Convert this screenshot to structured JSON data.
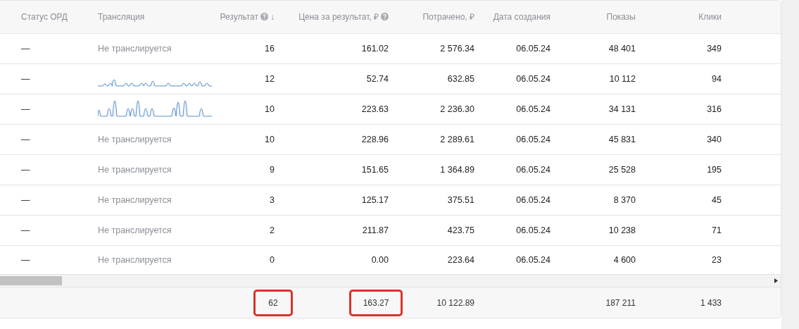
{
  "table": {
    "columns": [
      {
        "label": "Статус ОРД"
      },
      {
        "label": "Трансляция"
      },
      {
        "label": "Результат",
        "help": true,
        "sorted": true,
        "sort_mark": "↓"
      },
      {
        "label": "Цена за результат, ₽",
        "help": true
      },
      {
        "label": "Потрачено, ₽"
      },
      {
        "label": "Дата создания"
      },
      {
        "label": "Показы"
      },
      {
        "label": "Клики"
      }
    ],
    "rows": [
      {
        "cells": [
          {
            "kind": "text",
            "text": "—"
          },
          {
            "kind": "text",
            "text": "Не транслируется"
          },
          {
            "kind": "text",
            "text": "16"
          },
          {
            "kind": "text",
            "text": "161.02"
          },
          {
            "kind": "text",
            "text": "2 576.34"
          },
          {
            "kind": "text",
            "text": "06.05.24"
          },
          {
            "kind": "text",
            "text": "48 401"
          },
          {
            "kind": "text",
            "text": "349"
          }
        ]
      },
      {
        "cells": [
          {
            "kind": "text",
            "text": "—"
          },
          {
            "kind": "sparkline"
          },
          {
            "kind": "text",
            "text": "12"
          },
          {
            "kind": "text",
            "text": "52.74"
          },
          {
            "kind": "text",
            "text": "632.85"
          },
          {
            "kind": "text",
            "text": "06.05.24"
          },
          {
            "kind": "text",
            "text": "10 112"
          },
          {
            "kind": "text",
            "text": "94"
          }
        ]
      },
      {
        "cells": [
          {
            "kind": "text",
            "text": "—"
          },
          {
            "kind": "sparkline"
          },
          {
            "kind": "text",
            "text": "10"
          },
          {
            "kind": "text",
            "text": "223.63"
          },
          {
            "kind": "text",
            "text": "2 236.30"
          },
          {
            "kind": "text",
            "text": "06.05.24"
          },
          {
            "kind": "text",
            "text": "34 131"
          },
          {
            "kind": "text",
            "text": "316"
          }
        ]
      },
      {
        "cells": [
          {
            "kind": "text",
            "text": "—"
          },
          {
            "kind": "text",
            "text": "Не транслируется"
          },
          {
            "kind": "text",
            "text": "10"
          },
          {
            "kind": "text",
            "text": "228.96"
          },
          {
            "kind": "text",
            "text": "2 289.61"
          },
          {
            "kind": "text",
            "text": "06.05.24"
          },
          {
            "kind": "text",
            "text": "45 831"
          },
          {
            "kind": "text",
            "text": "340"
          }
        ]
      },
      {
        "cells": [
          {
            "kind": "text",
            "text": "—"
          },
          {
            "kind": "text",
            "text": "Не транслируется"
          },
          {
            "kind": "text",
            "text": "9"
          },
          {
            "kind": "text",
            "text": "151.65"
          },
          {
            "kind": "text",
            "text": "1 364.89"
          },
          {
            "kind": "text",
            "text": "06.05.24"
          },
          {
            "kind": "text",
            "text": "25 528"
          },
          {
            "kind": "text",
            "text": "195"
          }
        ]
      },
      {
        "cells": [
          {
            "kind": "text",
            "text": "—"
          },
          {
            "kind": "text",
            "text": "Не транслируется"
          },
          {
            "kind": "text",
            "text": "3"
          },
          {
            "kind": "text",
            "text": "125.17"
          },
          {
            "kind": "text",
            "text": "375.51"
          },
          {
            "kind": "text",
            "text": "06.05.24"
          },
          {
            "kind": "text",
            "text": "8 370"
          },
          {
            "kind": "text",
            "text": "45"
          }
        ]
      },
      {
        "cells": [
          {
            "kind": "text",
            "text": "—"
          },
          {
            "kind": "text",
            "text": "Не транслируется"
          },
          {
            "kind": "text",
            "text": "2"
          },
          {
            "kind": "text",
            "text": "211.87"
          },
          {
            "kind": "text",
            "text": "423.75"
          },
          {
            "kind": "text",
            "text": "06.05.24"
          },
          {
            "kind": "text",
            "text": "10 238"
          },
          {
            "kind": "text",
            "text": "71"
          }
        ]
      },
      {
        "cells": [
          {
            "kind": "text",
            "text": "—"
          },
          {
            "kind": "text",
            "text": "Не транслируется"
          },
          {
            "kind": "text",
            "text": "0"
          },
          {
            "kind": "text",
            "text": "0.00"
          },
          {
            "kind": "text",
            "text": "223.64"
          },
          {
            "kind": "text",
            "text": "06.05.24"
          },
          {
            "kind": "text",
            "text": "4 600"
          },
          {
            "kind": "text",
            "text": "23"
          }
        ]
      }
    ],
    "totals": {
      "result": {
        "text": "62",
        "highlighted": true
      },
      "cost_per_result": {
        "text": "163.27",
        "highlighted": true
      },
      "spent": {
        "text": "10 122.89"
      },
      "impressions": {
        "text": "187 211"
      },
      "clicks": {
        "text": "1 433"
      }
    }
  }
}
